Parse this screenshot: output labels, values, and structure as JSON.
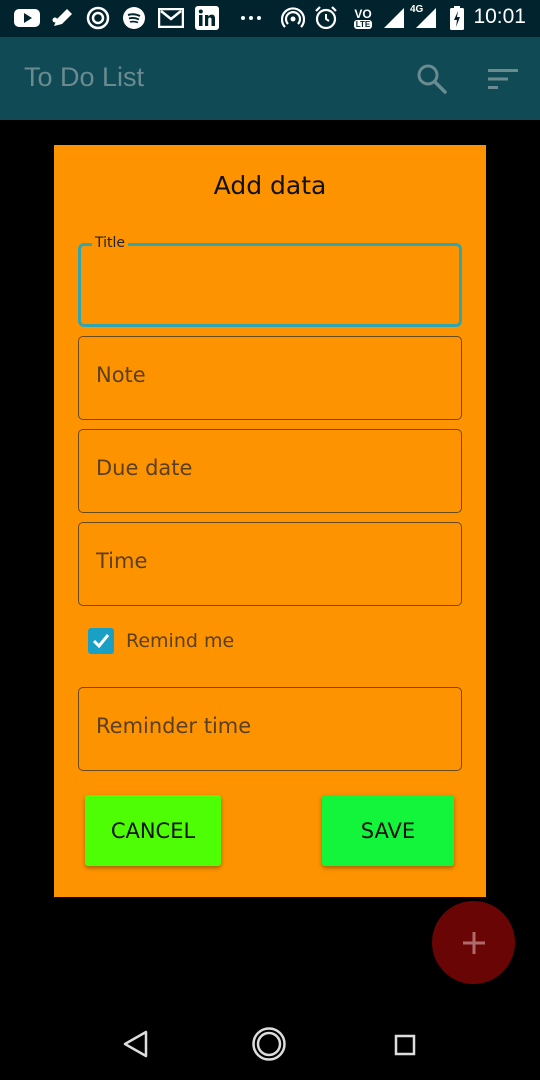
{
  "status_bar": {
    "time": "10:01",
    "network_badge": "4G",
    "volte_badge": "VO",
    "lte_badge": "LTE",
    "icons": [
      "youtube-icon",
      "edit-icon",
      "sync-icon",
      "spotify-icon",
      "gmail-icon",
      "linkedin-icon",
      "more-dots-icon",
      "hotspot-icon",
      "alarm-icon",
      "volte-icon",
      "signal-icon",
      "signal-4g-icon",
      "battery-icon"
    ]
  },
  "app_bar": {
    "title": "To Do List",
    "background": "#0f4a55",
    "icons": [
      "search-icon",
      "sort-icon"
    ]
  },
  "dialog": {
    "title": "Add data",
    "background": "#fe9300",
    "fields": {
      "title": {
        "label": "Title",
        "value": ""
      },
      "note": {
        "placeholder": "Note"
      },
      "due_date": {
        "placeholder": "Due date"
      },
      "time": {
        "placeholder": "Time"
      },
      "reminder_time": {
        "placeholder": "Reminder time"
      }
    },
    "remind_me": {
      "label": "Remind me",
      "checked": true
    },
    "buttons": {
      "cancel": "CANCEL",
      "save": "SAVE"
    }
  },
  "fab": {
    "icon": "plus-icon",
    "color": "#6a0505"
  },
  "nav_bar": {
    "icons": [
      "back-icon",
      "home-icon",
      "recent-apps-icon"
    ]
  }
}
